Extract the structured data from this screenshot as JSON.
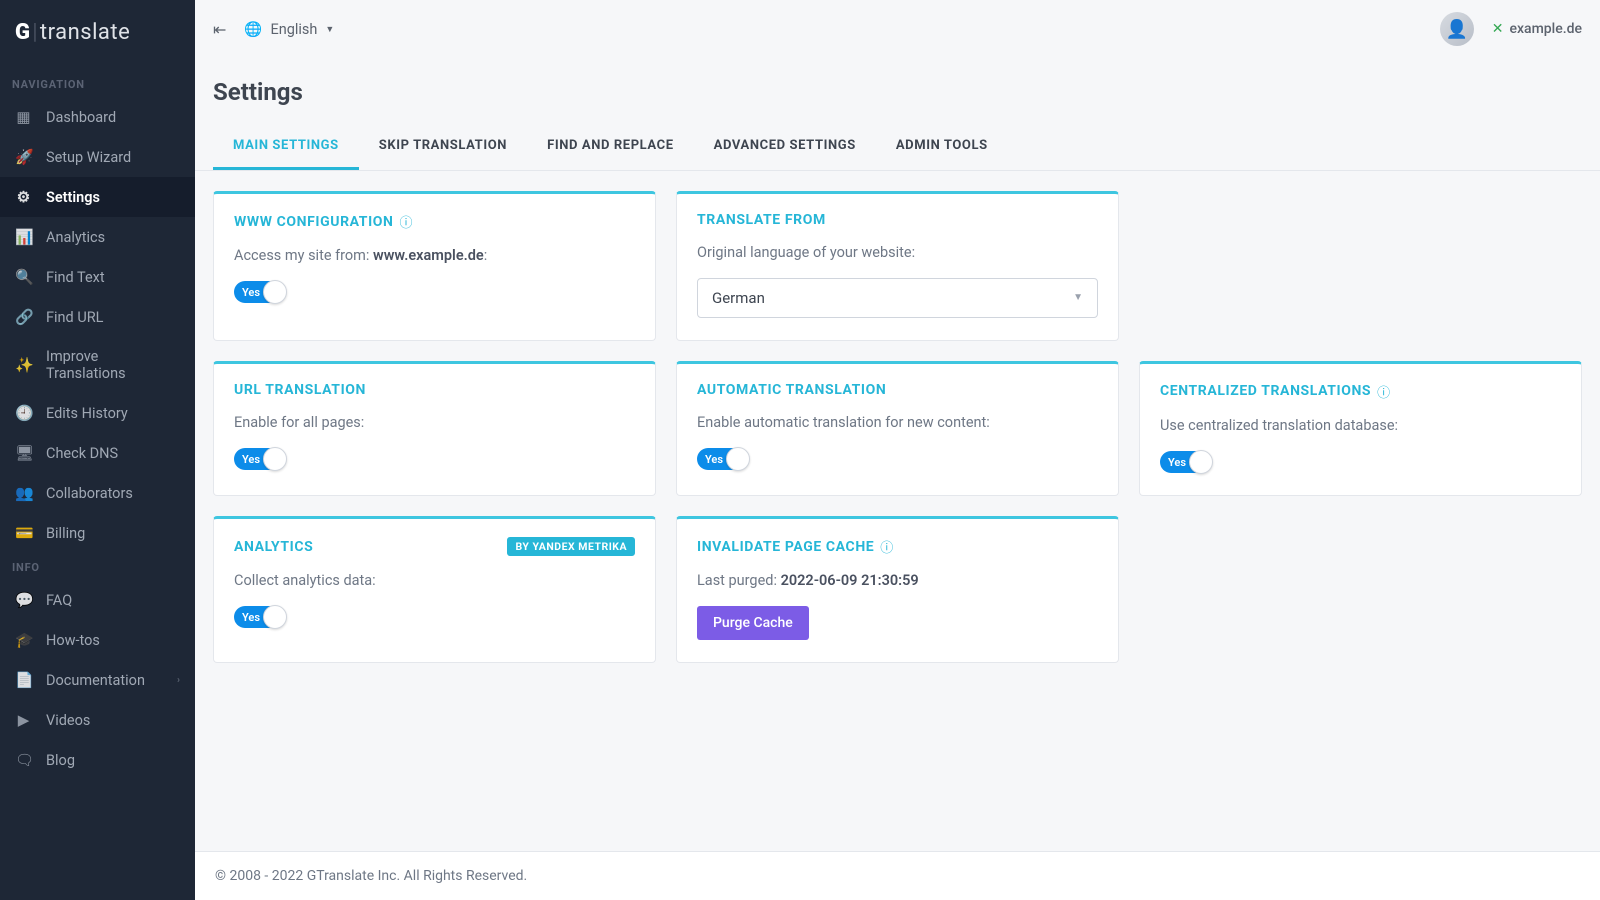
{
  "brand": {
    "g": "G",
    "divider": "|",
    "t": "translate"
  },
  "sidebar": {
    "section_nav": "NAVIGATION",
    "section_info": "INFO",
    "items_nav": [
      {
        "icon": "▦",
        "label": "Dashboard"
      },
      {
        "icon": "🚀",
        "label": "Setup Wizard"
      },
      {
        "icon": "⚙",
        "label": "Settings",
        "active": true
      },
      {
        "icon": "📊",
        "label": "Analytics"
      },
      {
        "icon": "🔍",
        "label": "Find Text"
      },
      {
        "icon": "🔗",
        "label": "Find URL"
      },
      {
        "icon": "✨",
        "label": "Improve Translations"
      },
      {
        "icon": "🕘",
        "label": "Edits History"
      },
      {
        "icon": "🖥",
        "label": "Check DNS"
      },
      {
        "icon": "👥",
        "label": "Collaborators"
      },
      {
        "icon": "💳",
        "label": "Billing"
      }
    ],
    "items_info": [
      {
        "icon": "💬",
        "label": "FAQ"
      },
      {
        "icon": "🎓",
        "label": "How-tos"
      },
      {
        "icon": "📄",
        "label": "Documentation",
        "chevron": true
      },
      {
        "icon": "▶",
        "label": "Videos"
      },
      {
        "icon": "🗨",
        "label": "Blog"
      }
    ]
  },
  "topbar": {
    "language": "English",
    "domain": "example.de"
  },
  "page": {
    "title": "Settings"
  },
  "tabs": [
    {
      "label": "MAIN SETTINGS",
      "active": true
    },
    {
      "label": "SKIP TRANSLATION"
    },
    {
      "label": "FIND AND REPLACE"
    },
    {
      "label": "ADVANCED SETTINGS"
    },
    {
      "label": "ADMIN TOOLS"
    }
  ],
  "cards": {
    "www": {
      "title": "WWW CONFIGURATION",
      "desc_pre": "Access my site from: ",
      "desc_bold": "www.example.de",
      "toggle": "Yes"
    },
    "translate_from": {
      "title": "TRANSLATE FROM",
      "desc": "Original language of your website:",
      "value": "German"
    },
    "url_trans": {
      "title": "URL TRANSLATION",
      "desc": "Enable for all pages:",
      "toggle": "Yes"
    },
    "auto_trans": {
      "title": "AUTOMATIC TRANSLATION",
      "desc": "Enable automatic translation for new content:",
      "toggle": "Yes"
    },
    "centralized": {
      "title": "CENTRALIZED TRANSLATIONS",
      "desc": "Use centralized translation database:",
      "toggle": "Yes"
    },
    "analytics": {
      "title": "ANALYTICS",
      "badge": "BY YANDEX METRIKA",
      "desc": "Collect analytics data:",
      "toggle": "Yes"
    },
    "purge": {
      "title": "INVALIDATE PAGE CACHE",
      "desc_pre": "Last purged: ",
      "desc_bold": "2022-06-09 21:30:59",
      "btn": "Purge Cache"
    }
  },
  "footer": "© 2008 - 2022 GTranslate Inc. All Rights Reserved."
}
